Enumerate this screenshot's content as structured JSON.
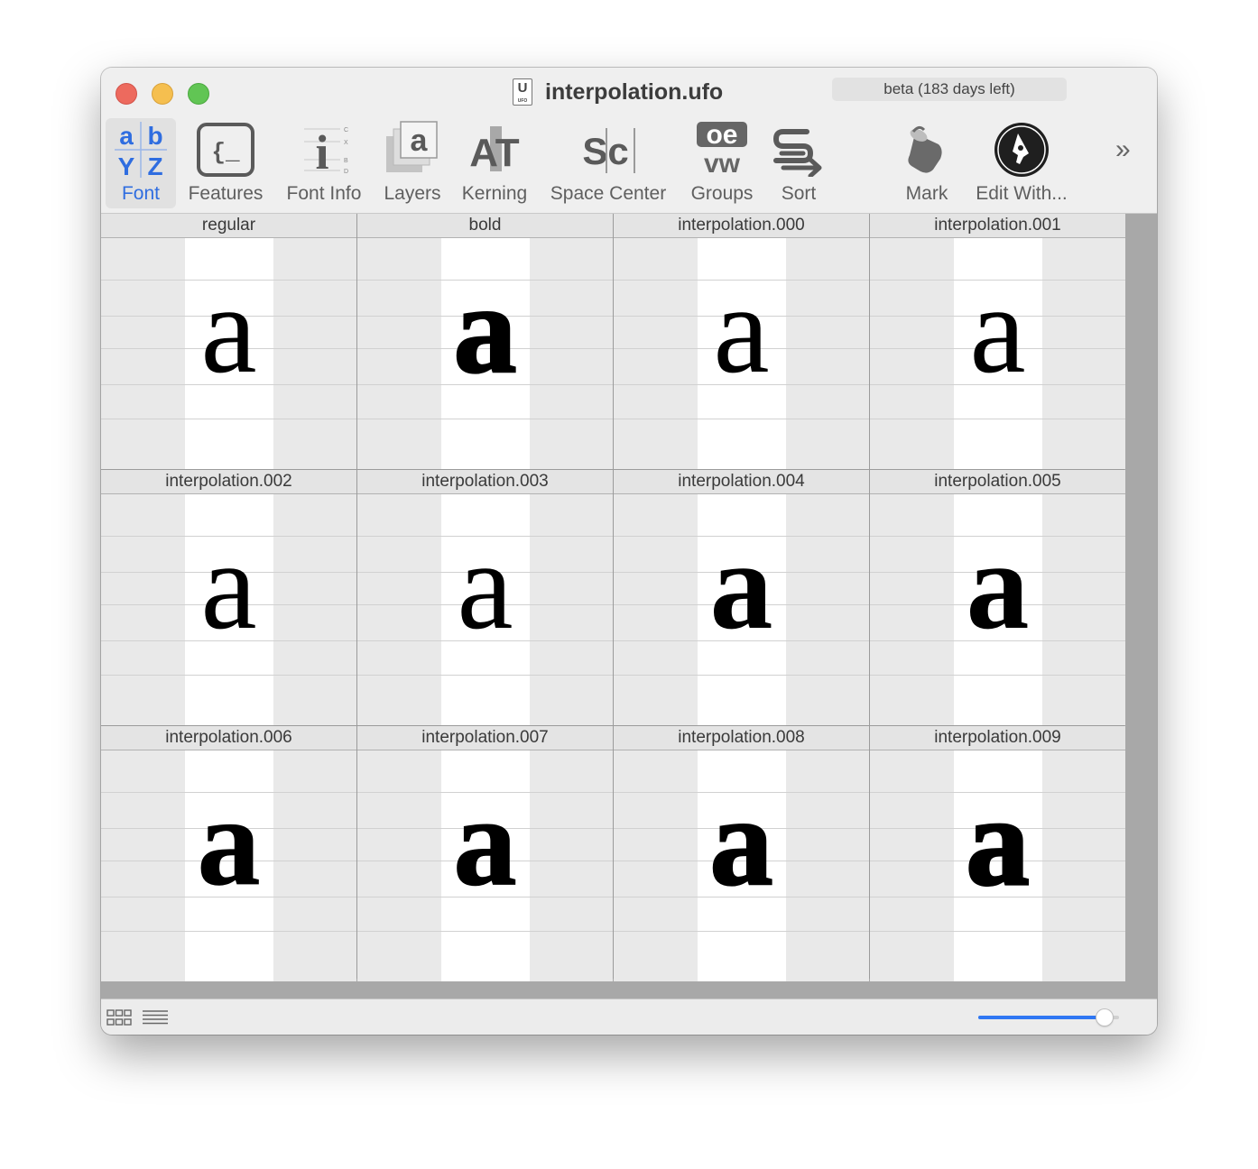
{
  "window": {
    "title": "interpolation.ufo",
    "file_badge": {
      "letter": "U",
      "caption": "UFO"
    },
    "beta_label": "beta (183 days left)"
  },
  "toolbar": {
    "items": [
      {
        "label": "Font",
        "icon": "font-collection-icon",
        "active": true
      },
      {
        "label": "Features",
        "icon": "features-braces-icon",
        "active": false
      },
      {
        "label": "Font Info",
        "icon": "font-info-icon",
        "active": false
      },
      {
        "label": "Layers",
        "icon": "layers-icon",
        "active": false
      },
      {
        "label": "Kerning",
        "icon": "kerning-icon",
        "active": false
      },
      {
        "label": "Space Center",
        "icon": "space-center-icon",
        "active": false
      },
      {
        "label": "Groups",
        "icon": "groups-icon",
        "active": false
      },
      {
        "label": "Sort",
        "icon": "sort-icon",
        "active": false
      },
      {
        "label": "Mark",
        "icon": "mark-paint-bucket-icon",
        "active": false
      },
      {
        "label": "Edit With...",
        "icon": "edit-with-pen-icon",
        "active": false
      }
    ],
    "icon_text": {
      "font": [
        "a",
        "b",
        "Y",
        "Z"
      ],
      "features": "{_",
      "font_info": "i",
      "font_info_ticks": [
        "C",
        "X",
        "B",
        "D"
      ],
      "layers": "a",
      "kerning": "AT",
      "space_center": "Sc",
      "groups_top": "oe",
      "groups_bottom": "vw"
    },
    "overflow_icon": "chevron-double-right-icon",
    "active_color": "#2f6de0"
  },
  "glyphs": [
    {
      "name": "regular",
      "char": "a",
      "weight": 400
    },
    {
      "name": "bold",
      "char": "a",
      "weight": 900
    },
    {
      "name": "interpolation.000",
      "char": "a",
      "weight": 300
    },
    {
      "name": "interpolation.001",
      "char": "a",
      "weight": 350
    },
    {
      "name": "interpolation.002",
      "char": "a",
      "weight": 400
    },
    {
      "name": "interpolation.003",
      "char": "a",
      "weight": 500
    },
    {
      "name": "interpolation.004",
      "char": "a",
      "weight": 600
    },
    {
      "name": "interpolation.005",
      "char": "a",
      "weight": 700
    },
    {
      "name": "interpolation.006",
      "char": "a",
      "weight": 800
    },
    {
      "name": "interpolation.007",
      "char": "a",
      "weight": 850
    },
    {
      "name": "interpolation.008",
      "char": "a",
      "weight": 900
    },
    {
      "name": "interpolation.009",
      "char": "a",
      "weight": 950
    }
  ],
  "bottom": {
    "view_icons": [
      "grid-view-icon",
      "list-view-icon"
    ],
    "zoom_slider_value": 0.9
  }
}
